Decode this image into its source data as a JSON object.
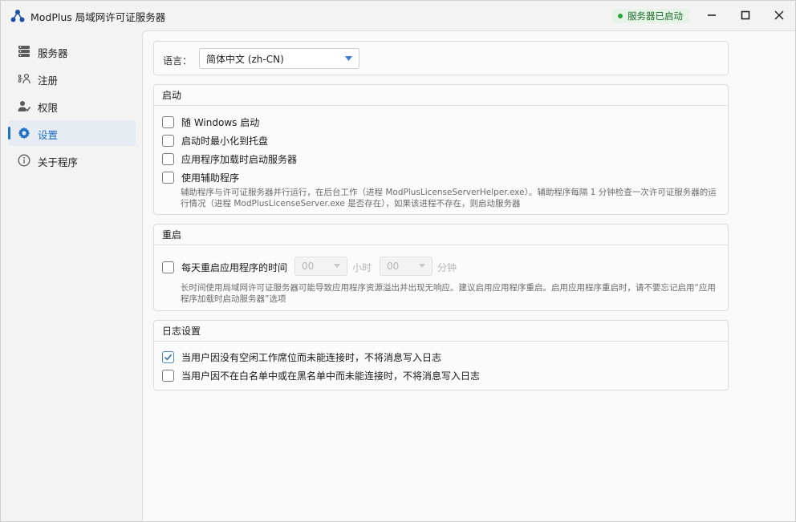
{
  "app": {
    "title": "ModPlus 局域网许可证服务器",
    "status": "服务器已启动",
    "colors": {
      "accent": "#1e6fc8",
      "status_green": "#2aa33a"
    }
  },
  "sidebar": {
    "items": [
      {
        "label": "服务器",
        "icon": "server-icon"
      },
      {
        "label": "注册",
        "icon": "register-icon"
      },
      {
        "label": "权限",
        "icon": "permissions-icon"
      },
      {
        "label": "设置",
        "icon": "gear-icon",
        "active": true
      },
      {
        "label": "关于程序",
        "icon": "info-icon"
      }
    ]
  },
  "settings": {
    "language": {
      "label": "语言：",
      "selected": "简体中文 (zh-CN)"
    },
    "startup": {
      "header": "启动",
      "options": [
        {
          "label": "随 Windows 启动",
          "checked": false
        },
        {
          "label": "启动时最小化到托盘",
          "checked": false
        },
        {
          "label": "应用程序加载时启动服务器",
          "checked": false
        },
        {
          "label": "使用辅助程序",
          "checked": false
        }
      ],
      "helper_description": "辅助程序与许可证服务器并行运行，在后台工作（进程 ModPlusLicenseServerHelper.exe）。辅助程序每隔 1 分钟检查一次许可证服务器的运行情况（进程 ModPlusLicenseServer.exe 是否存在），如果该进程不存在，则启动服务器"
    },
    "restart": {
      "header": "重启",
      "option_label": "每天重启应用程序的时间",
      "checked": false,
      "hours_value": "00",
      "hours_unit": "小时",
      "minutes_value": "00",
      "minutes_unit": "分钟",
      "description": "长时间使用局域网许可证服务器可能导致应用程序资源溢出并出现无响应。建议启用应用程序重启。启用应用程序重启时，请不要忘记启用“应用程序加载时启动服务器”选项"
    },
    "logging": {
      "header": "日志设置",
      "options": [
        {
          "label": "当用户因没有空闲工作席位而未能连接时，不将消息写入日志",
          "checked": true
        },
        {
          "label": "当用户因不在白名单中或在黑名单中而未能连接时，不将消息写入日志",
          "checked": false
        }
      ]
    }
  }
}
